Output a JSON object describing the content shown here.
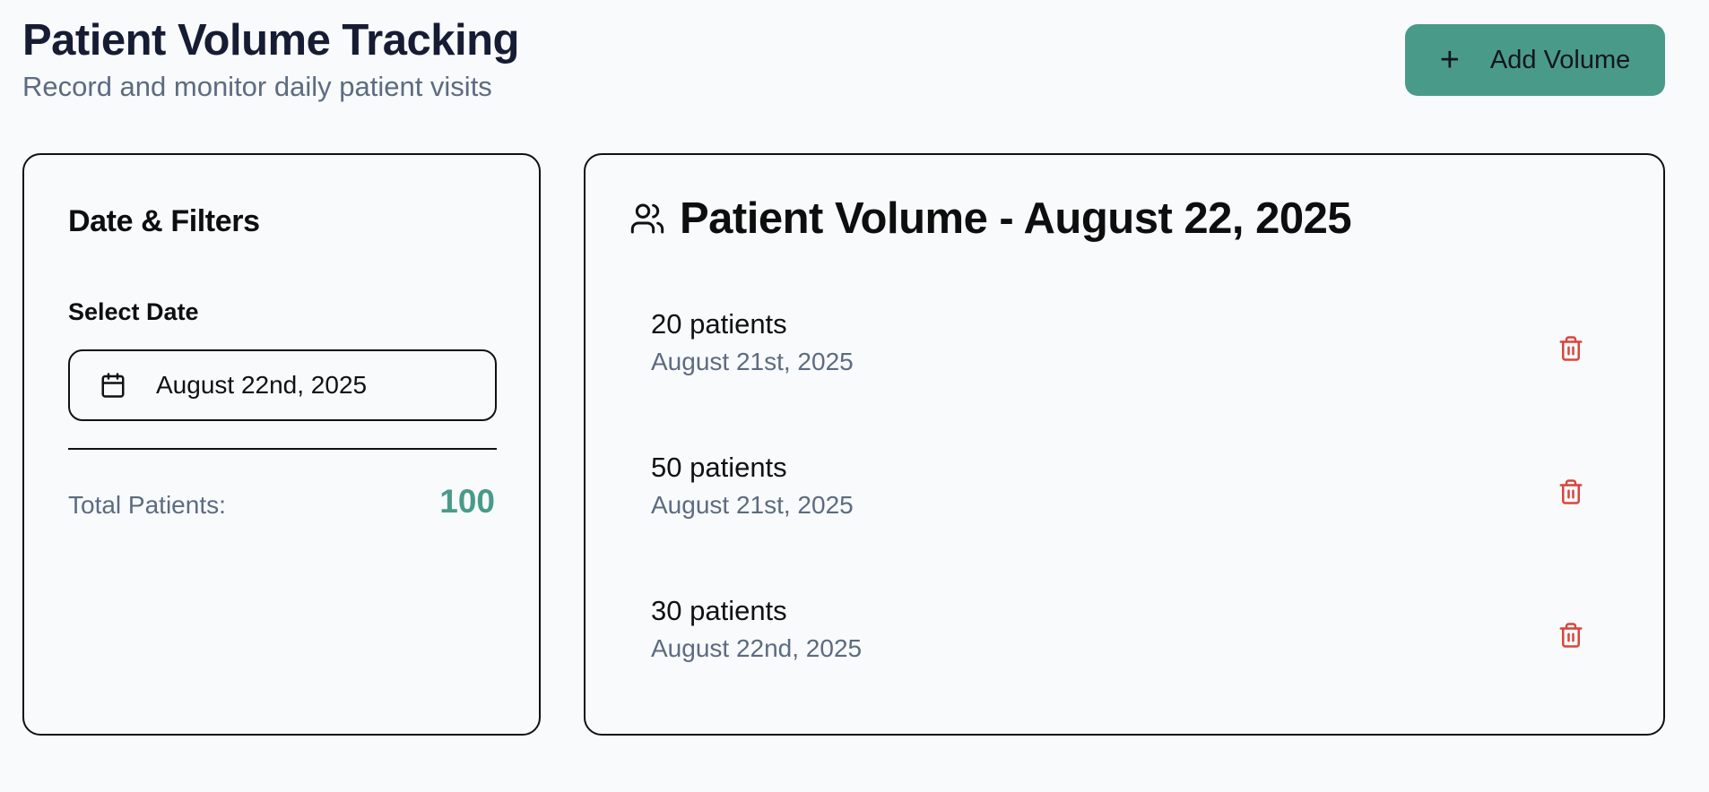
{
  "header": {
    "title": "Patient Volume Tracking",
    "subtitle": "Record and monitor daily patient visits",
    "add_button_label": "Add Volume",
    "add_button_icon": "plus-icon"
  },
  "filters": {
    "title": "Date & Filters",
    "select_date_label": "Select Date",
    "selected_date": "August 22nd, 2025",
    "date_icon": "calendar-icon",
    "total_label": "Total Patients:",
    "total_value": "100"
  },
  "volume": {
    "title": "Patient Volume - August 22, 2025",
    "title_icon": "users-icon",
    "entries": [
      {
        "count": "20 patients",
        "date": "August 21st, 2025"
      },
      {
        "count": "50 patients",
        "date": "August 21st, 2025"
      },
      {
        "count": "30 patients",
        "date": "August 22nd, 2025"
      }
    ],
    "delete_icon": "trash-icon"
  },
  "colors": {
    "accent": "#4a9a8a",
    "danger": "#d9453c",
    "muted_text": "#5d6b80",
    "background": "#f8fafc"
  }
}
